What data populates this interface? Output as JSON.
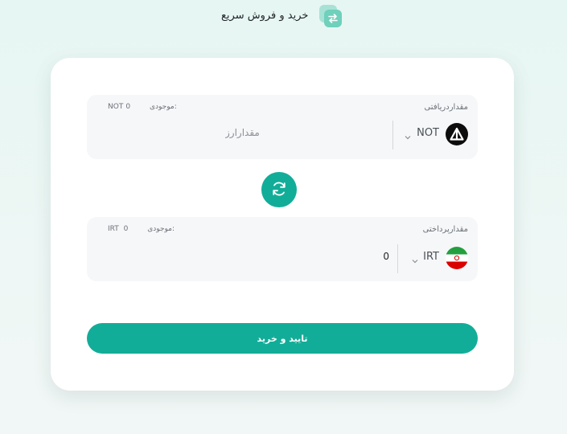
{
  "header": {
    "title": "خرید و فروش سریع",
    "icon": "swap-arrows-icon"
  },
  "receive": {
    "label": "مقداردریافتی",
    "balance_label": "موجودی:",
    "balance_value": "0",
    "balance_currency": "NOT",
    "currency_symbol": "NOT",
    "currency_icon": "notcoin-icon",
    "amount_placeholder": "مقدارارز",
    "amount_value": ""
  },
  "swap": {
    "icon": "refresh-icon"
  },
  "pay": {
    "label": "مقدارپرداختی",
    "balance_label": "موجودی:",
    "balance_value": "0",
    "balance_currency": "IRT",
    "currency_symbol": "IRT",
    "currency_icon": "iran-flag-icon",
    "amount_value": "0"
  },
  "confirm": {
    "label": "تایید و خرید"
  },
  "colors": {
    "accent": "#12ad98",
    "background": "#e6f6f3",
    "card": "#ffffff",
    "field": "#f6f7f9"
  }
}
